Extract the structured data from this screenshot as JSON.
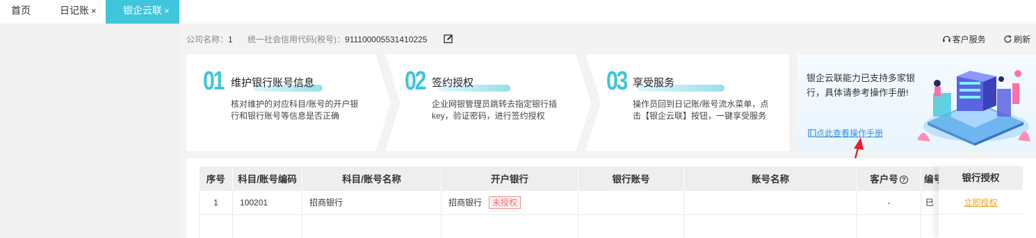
{
  "tabs": [
    {
      "label": "首页",
      "active": false,
      "closable": false
    },
    {
      "label": "日记账",
      "active": false,
      "closable": true
    },
    {
      "label": "银企云联",
      "active": true,
      "closable": true
    }
  ],
  "close_glyph": "×",
  "company": {
    "name_label": "公司名称：",
    "name_value": "1",
    "credit_label": "统一社会信用代码(税号)：",
    "credit_value": "911100005531410225"
  },
  "toplinks": {
    "service": "客户服务",
    "refresh": "刷新"
  },
  "steps": [
    {
      "num": "01",
      "title": "维护银行账号信息",
      "desc": "核对维护的对应科目/账号的开户银行和银行账号等信息是否正确"
    },
    {
      "num": "02",
      "title": "签约授权",
      "desc": "企业网银管理员跳转去指定银行插key，验证密码，进行签约授权"
    },
    {
      "num": "03",
      "title": "享受服务",
      "desc": "操作员回到日记账/账号流水菜单，点击【银企云联】按钮，一键享受服务"
    }
  ],
  "promo": {
    "text": "银企云联能力已支持多家银行，具体请参考操作手册!",
    "link": "点此查看操作手册"
  },
  "table": {
    "headers": [
      "序号",
      "科目/账号编码",
      "科目/账号名称",
      "开户银行",
      "银行账号",
      "账号名称",
      "客户号",
      "编号"
    ],
    "customer_help_glyph": "?",
    "rows": [
      {
        "index": "1",
        "code": "100201",
        "name": "招商银行",
        "bank": "招商银行",
        "status": "未授权",
        "account": "",
        "account_name": "",
        "customer_no": "-",
        "extra": "巳"
      }
    ],
    "auth_header": "银行授权",
    "auth_action": "立即授权"
  },
  "colors": {
    "accent": "#3ec6dc",
    "badge_red": "#f56c6c",
    "link_blue": "#3a8ee6",
    "action_orange": "#f0a020",
    "arrow_red": "#e8202a"
  }
}
